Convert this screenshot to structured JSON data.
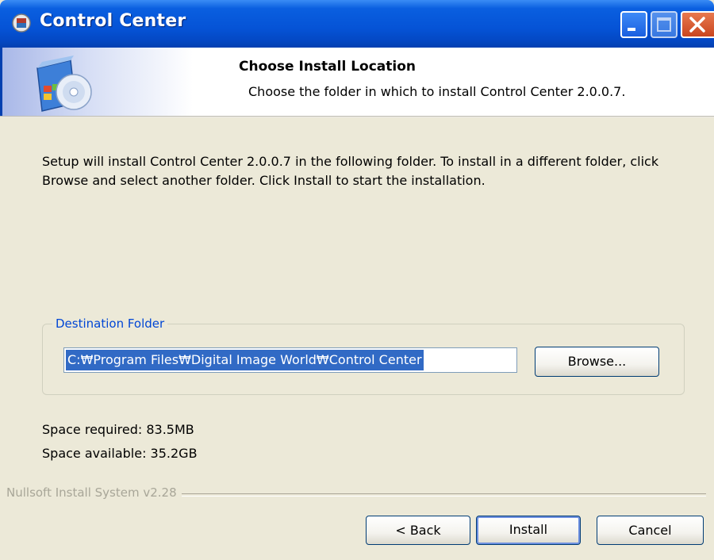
{
  "window": {
    "title": "Control Center",
    "icon": "installer-app-icon",
    "controls": [
      "minimize-icon",
      "maximize-icon",
      "close-icon"
    ]
  },
  "header": {
    "title": "Choose Install Location",
    "subtitle": "Choose the folder in which to install Control Center 2.0.0.7.",
    "icon": "install-disc-box-icon"
  },
  "body": {
    "description": "Setup will install Control Center 2.0.0.7 in the following folder. To install in a different folder, click Browse and select another folder. Click Install to start the installation."
  },
  "destination": {
    "legend": "Destination Folder",
    "path": "C:\\Program Files\\Digital Image World\\Control Center",
    "path_display": "C:₩Program Files₩Digital Image World₩Control Center",
    "browse_label": "Browse..."
  },
  "space": {
    "required": "Space required: 83.5MB",
    "available": "Space available: 35.2GB"
  },
  "footer": {
    "branding": "Nullsoft Install System v2.28",
    "back_label": "< Back",
    "install_label": "Install",
    "cancel_label": "Cancel"
  },
  "colors": {
    "titlebar": "#0553d6",
    "dialog_bg": "#ece9d8",
    "selection": "#316ac5",
    "legend_text": "#0046d5"
  }
}
